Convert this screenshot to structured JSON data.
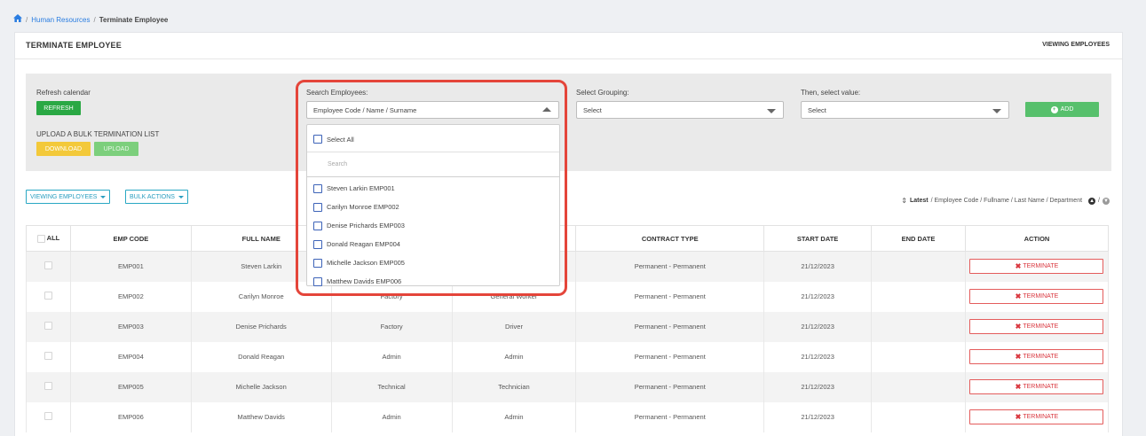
{
  "breadcrumb": {
    "items": [
      "Human Resources",
      "Terminate Employee"
    ],
    "separator": "/"
  },
  "card": {
    "title": "TERMINATE EMPLOYEE",
    "right_label": "VIEWING EMPLOYEES"
  },
  "filters": {
    "refresh_label": "Refresh calendar",
    "refresh_button": "REFRESH",
    "bulk_label": "UPLOAD A BULK TERMINATION LIST",
    "download_button": "DOWNLOAD",
    "upload_button": "UPLOAD",
    "search_label": "Search Employees:",
    "search_value": "Employee Code / Name / Surname",
    "grouping_label": "Select Grouping:",
    "grouping_value": "Select",
    "value_label": "Then, select value:",
    "value_value": "Select",
    "add_button": "ADD",
    "add_icon": "+"
  },
  "dropdown": {
    "select_all": "Select All",
    "search_placeholder": "Search",
    "items": [
      "Steven Larkin EMP001",
      "Carilyn Monroe EMP002",
      "Denise Prichards EMP003",
      "Donald Reagan EMP004",
      "Michelle Jackson EMP005",
      "Matthew Davids EMP006"
    ]
  },
  "toolbar": {
    "viewing_button": "VIEWING EMPLOYEES",
    "bulk_button": "BULK ACTIONS"
  },
  "sort": {
    "icon": "⇕",
    "active": "Latest",
    "options": "/ Employee Code / Fullname / Last Name / Department",
    "up_icon": "▲",
    "slash": "/",
    "down_icon": "▼"
  },
  "table": {
    "headers": {
      "all": "ALL",
      "emp_code": "EMP CODE",
      "full_name": "FULL NAME",
      "contract_type": "CONTRACT TYPE",
      "start_date": "START DATE",
      "end_date": "END DATE",
      "action": "ACTION"
    },
    "terminate_label": "TERMINATE",
    "terminate_icon": "✖",
    "rows": [
      {
        "code": "EMP001",
        "name": "Steven Larkin",
        "department": "",
        "position": "",
        "contract": "Permanent - Permanent",
        "start": "21/12/2023",
        "end": ""
      },
      {
        "code": "EMP002",
        "name": "Carilyn Monroe",
        "department": "Factory",
        "position": "General Worker",
        "contract": "Permanent - Permanent",
        "start": "21/12/2023",
        "end": ""
      },
      {
        "code": "EMP003",
        "name": "Denise Prichards",
        "department": "Factory",
        "position": "Driver",
        "contract": "Permanent - Permanent",
        "start": "21/12/2023",
        "end": ""
      },
      {
        "code": "EMP004",
        "name": "Donald Reagan",
        "department": "Admin",
        "position": "Admin",
        "contract": "Permanent - Permanent",
        "start": "21/12/2023",
        "end": ""
      },
      {
        "code": "EMP005",
        "name": "Michelle Jackson",
        "department": "Technical",
        "position": "Technician",
        "contract": "Permanent - Permanent",
        "start": "21/12/2023",
        "end": ""
      },
      {
        "code": "EMP006",
        "name": "Matthew Davids",
        "department": "Admin",
        "position": "Admin",
        "contract": "Permanent - Permanent",
        "start": "21/12/2023",
        "end": ""
      }
    ]
  },
  "colors": {
    "accent": "#2a7de1",
    "green": "#2aa844",
    "danger": "#d9363e",
    "highlight": "#e4453a"
  }
}
